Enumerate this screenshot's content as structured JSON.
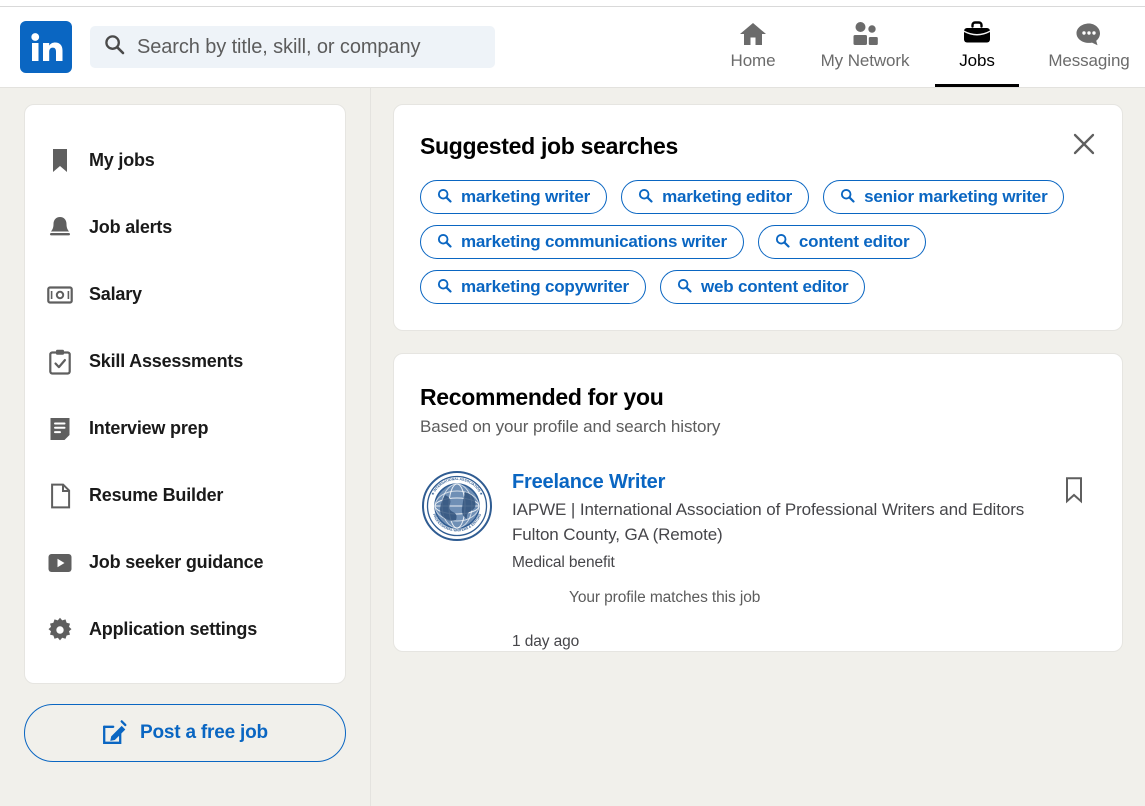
{
  "brand": {
    "logo_text": "in",
    "logo_color": "#0a66c2"
  },
  "search": {
    "placeholder": "Search by title, skill, or company",
    "value": "",
    "icon": "search-icon"
  },
  "nav": {
    "items": [
      {
        "label": "Home",
        "icon": "home-icon",
        "active": false
      },
      {
        "label": "My Network",
        "icon": "people-icon",
        "active": false
      },
      {
        "label": "Jobs",
        "icon": "briefcase-icon",
        "active": true
      },
      {
        "label": "Messaging",
        "icon": "message-bubble-icon",
        "active": false
      }
    ]
  },
  "sidebar": {
    "items": [
      {
        "label": "My jobs",
        "icon": "bookmark-icon"
      },
      {
        "label": "Job alerts",
        "icon": "bell-icon"
      },
      {
        "label": "Salary",
        "icon": "money-icon"
      },
      {
        "label": "Skill Assessments",
        "icon": "clipboard-check-icon"
      },
      {
        "label": "Interview prep",
        "icon": "document-lines-icon"
      },
      {
        "label": "Resume Builder",
        "icon": "page-icon"
      },
      {
        "label": "Job seeker guidance",
        "icon": "video-play-icon"
      },
      {
        "label": "Application settings",
        "icon": "gear-icon"
      }
    ],
    "post_job": {
      "label": "Post a free job",
      "icon": "compose-pencil-icon",
      "color": "#0a66c2"
    }
  },
  "suggested": {
    "title": "Suggested job searches",
    "close_icon": "close-icon",
    "pills": [
      {
        "label": "marketing writer",
        "icon": "search-icon"
      },
      {
        "label": "marketing editor",
        "icon": "search-icon"
      },
      {
        "label": "senior marketing writer",
        "icon": "search-icon"
      },
      {
        "label": "marketing communications writer",
        "icon": "search-icon"
      },
      {
        "label": "content editor",
        "icon": "search-icon"
      },
      {
        "label": "marketing copywriter",
        "icon": "search-icon"
      },
      {
        "label": "web content editor",
        "icon": "search-icon"
      }
    ]
  },
  "recommended": {
    "title": "Recommended for you",
    "subtitle": "Based on your profile and search history",
    "jobs": [
      {
        "title": "Freelance Writer",
        "company": "IAPWE | International Association of Professional Writers and Editors",
        "location": "Fulton County, GA (Remote)",
        "benefit": "Medical benefit",
        "match": "Your profile matches this job",
        "posted": "1 day ago",
        "logo": "iapwe-seal-logo",
        "save_icon": "bookmark-icon"
      }
    ]
  }
}
